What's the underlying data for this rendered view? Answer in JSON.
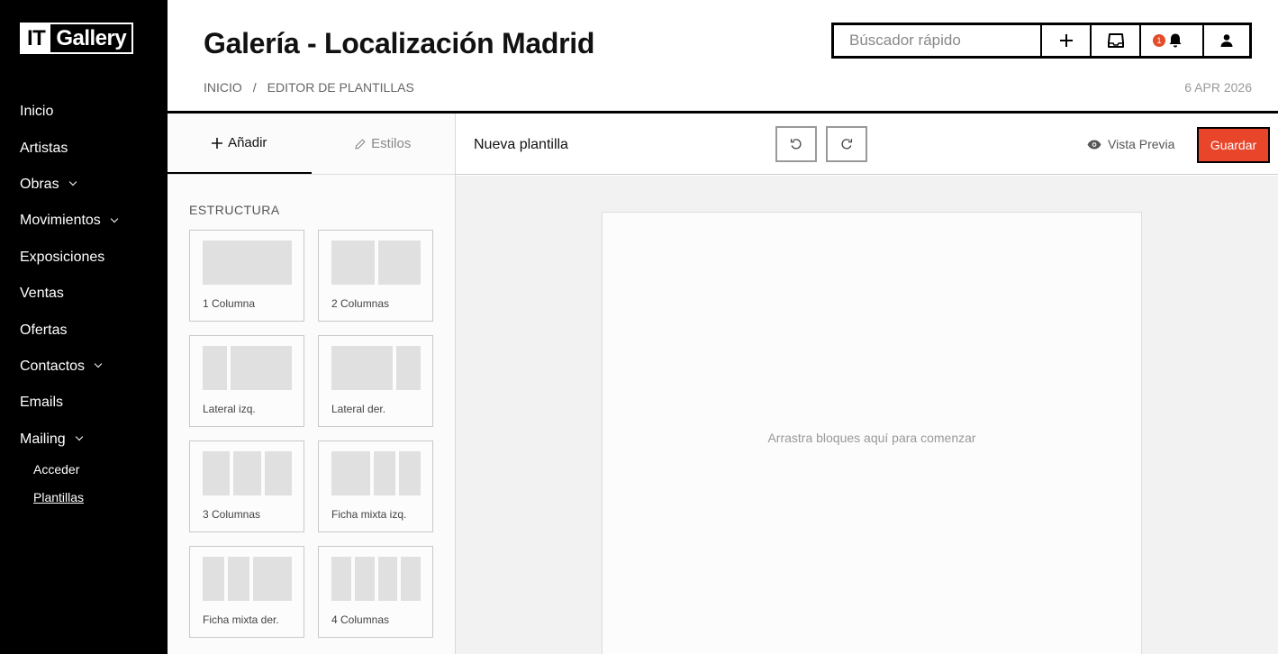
{
  "brand": {
    "logo_left": "IT",
    "logo_right": "Gallery"
  },
  "sidebar": {
    "items": [
      {
        "label": "Inicio"
      },
      {
        "label": "Artistas"
      },
      {
        "label": "Obras"
      },
      {
        "label": "Movimientos"
      },
      {
        "label": "Exposiciones"
      },
      {
        "label": "Ventas"
      },
      {
        "label": "Ofertas"
      },
      {
        "label": "Contactos"
      },
      {
        "label": "Emails"
      },
      {
        "label": "Mailing"
      }
    ],
    "subitems": [
      {
        "label": "Acceder"
      },
      {
        "label": "Plantillas",
        "active": true
      }
    ]
  },
  "header": {
    "title": "Galería - Localización Madrid",
    "breadcrumb": {
      "home": "INICIO",
      "separator": "/",
      "current": "EDITOR DE PLANTILLAS"
    },
    "date": "6 APR 2026",
    "search_placeholder": "Búscador rápido",
    "notification_count": "1"
  },
  "left_panel": {
    "tabs": [
      {
        "label": "Añadir",
        "icon": "plus-icon",
        "active": true
      },
      {
        "label": "Estilos",
        "icon": "pencil-icon",
        "active": false
      }
    ],
    "section_title": "ESTRUCTURA",
    "layouts": [
      {
        "label": "1 Columna"
      },
      {
        "label": "2 Columnas"
      },
      {
        "label": "Lateral izq."
      },
      {
        "label": "Lateral der."
      },
      {
        "label": "3 Columnas"
      },
      {
        "label": "Ficha mixta izq."
      },
      {
        "label": "Ficha mixta der."
      },
      {
        "label": "4 Columnas"
      }
    ]
  },
  "editor": {
    "template_name": "Nueva plantilla",
    "preview_label": "Vista Previa",
    "save_label": "Guardar",
    "drop_hint": "Arrastra bloques aquí para comenzar"
  },
  "colors": {
    "accent": "#e8452a",
    "badge": "#e34d2b",
    "sidebar_bg": "#000000"
  }
}
